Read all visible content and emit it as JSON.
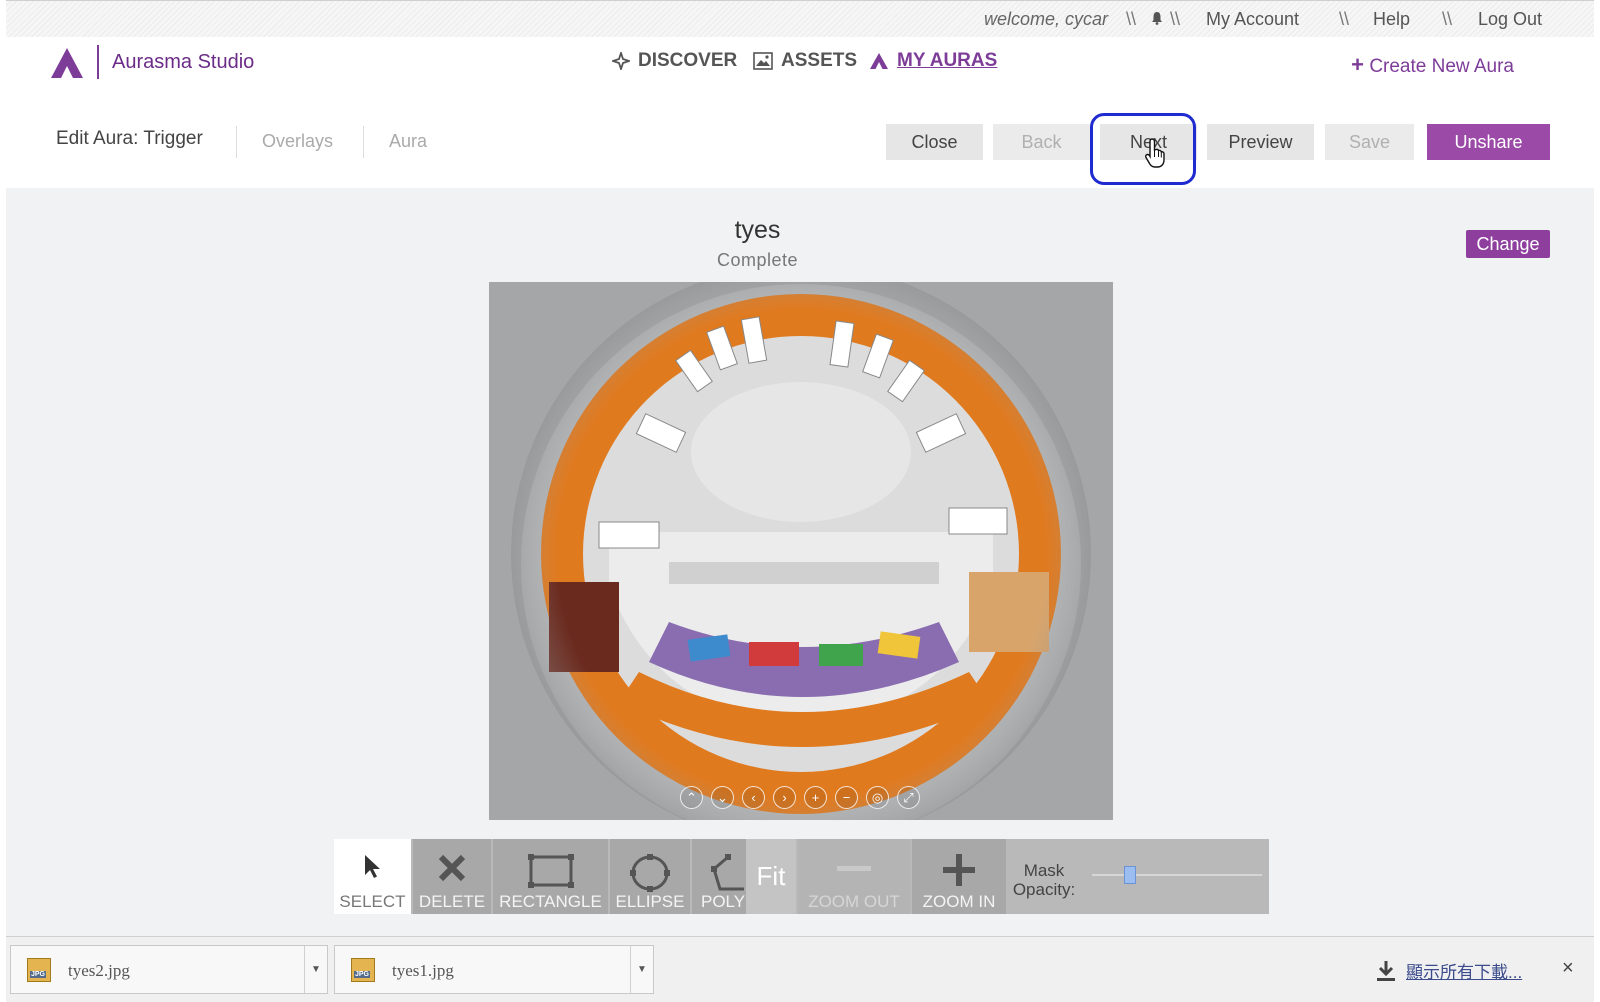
{
  "topbar": {
    "welcome": "welcome, cycar",
    "separator": "\\\\",
    "my_account": "My Account",
    "help": "Help",
    "log_out": "Log Out"
  },
  "header": {
    "brand": "Aurasma Studio",
    "nav": [
      {
        "label": "DISCOVER",
        "icon": "compass-icon"
      },
      {
        "label": "ASSETS",
        "icon": "image-icon"
      },
      {
        "label": "MY AURAS",
        "icon": "aurasma-logo-icon",
        "active": true
      }
    ],
    "create_new": "Create New Aura"
  },
  "edit": {
    "label_prefix": "Edit Aura:",
    "current_step": "Trigger",
    "steps": [
      "Overlays",
      "Aura"
    ],
    "buttons": {
      "close": "Close",
      "back": "Back",
      "next": "Next",
      "preview": "Preview",
      "save": "Save",
      "unshare": "Unshare"
    }
  },
  "trigger": {
    "name": "tyes",
    "status": "Complete",
    "change": "Change",
    "controls": [
      "up-icon",
      "down-icon",
      "left-icon",
      "right-icon",
      "zoom-in-icon",
      "zoom-out-icon",
      "reset-icon",
      "fullscreen-icon"
    ]
  },
  "toolbar": {
    "select": "SELECT",
    "delete": "DELETE",
    "rectangle": "RECTANGLE",
    "ellipse": "ELLIPSE",
    "polygon": "POLY",
    "fit": "Fit",
    "zoom_out": "ZOOM OUT",
    "zoom_in": "ZOOM IN",
    "mask_opacity": "Mask Opacity:",
    "mask_opacity_value": 0.2
  },
  "downloads": {
    "files": [
      "tyes2.jpg",
      "tyes1.jpg"
    ],
    "file_type": "JPG",
    "show_all": "顯示所有下載...",
    "close": "×"
  },
  "colors": {
    "brand_purple": "#7d3c98",
    "primary_button": "#9b4aa8",
    "highlight_ring": "#1f2bd0"
  }
}
